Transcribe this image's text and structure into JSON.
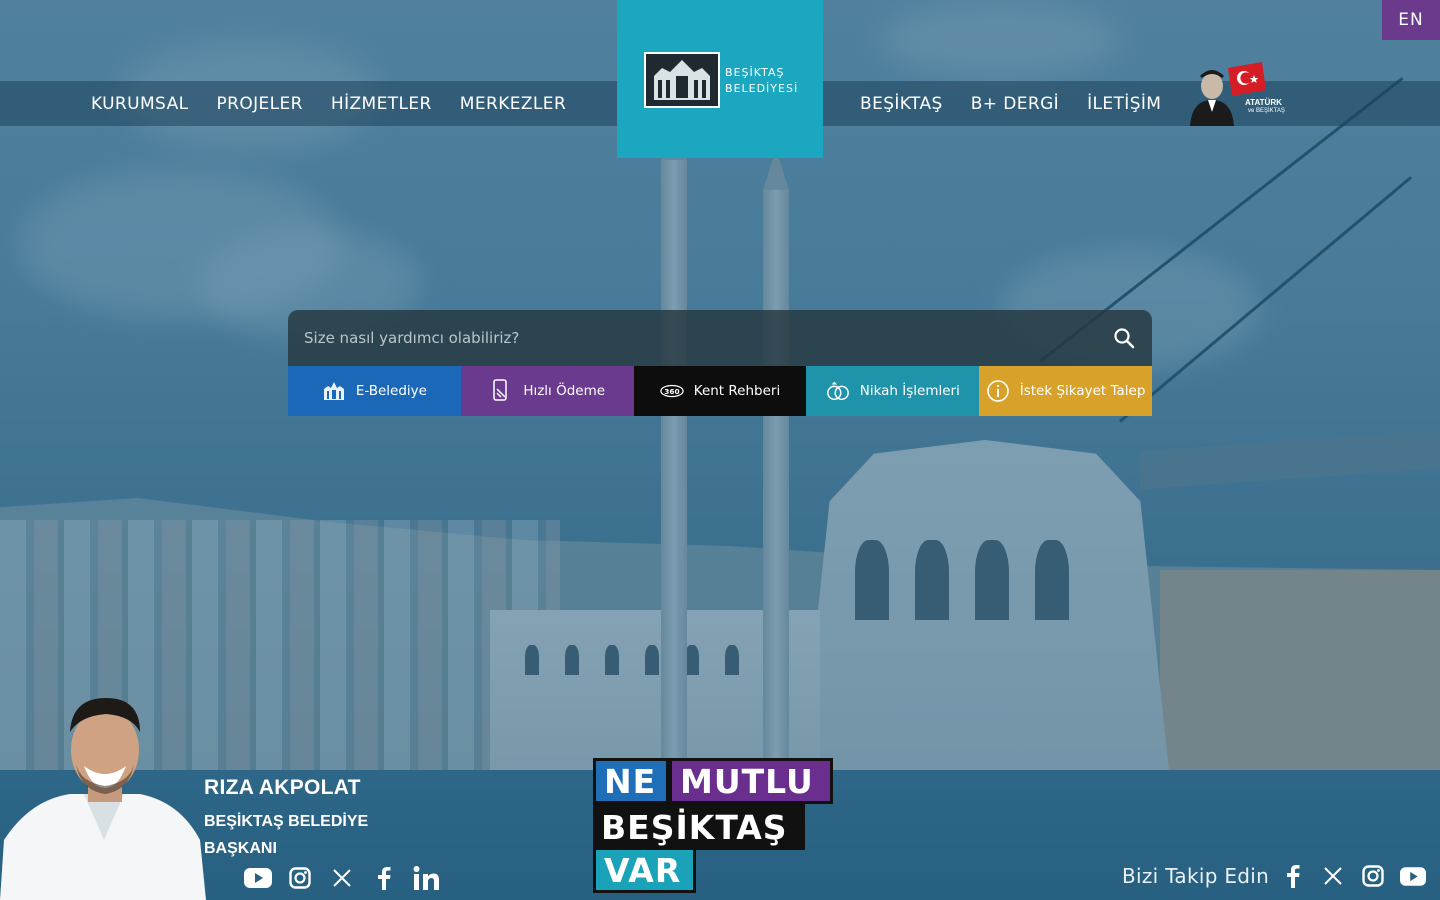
{
  "lang_toggle": "EN",
  "nav": {
    "left": [
      "KURUMSAL",
      "PROJELER",
      "HİZMETLER",
      "MERKEZLER"
    ],
    "right": [
      "BEŞİKTAŞ",
      "B+ DERGİ",
      "İLETİŞİM"
    ]
  },
  "logo": {
    "line1": "BEŞİKTAŞ",
    "line2": "BELEDİYESİ"
  },
  "ataturk_badge": {
    "title": "ATATÜRK",
    "subtitle": "ve BEŞİKTAŞ"
  },
  "search": {
    "placeholder": "Size nasıl yardımcı olabiliriz?"
  },
  "quick_links": [
    {
      "label": "E-Belediye",
      "color": "#1c68b8",
      "icon": "building-icon"
    },
    {
      "label": "Hızlı Ödeme",
      "color": "#6a3a8e",
      "icon": "card-icon"
    },
    {
      "label": "Kent Rehberi",
      "color": "#0d0d0d",
      "icon": "360-icon"
    },
    {
      "label": "Nikah İşlemleri",
      "color": "#1f93aa",
      "icon": "rings-icon"
    },
    {
      "label": "İstek Şikayet Talep",
      "color": "#d8a12a",
      "icon": "info-icon"
    }
  ],
  "mayor": {
    "name": "RIZA AKPOLAT",
    "title_line1": "BEŞİKTAŞ BELEDİYE",
    "title_line2": "BAŞKANI"
  },
  "slogan": {
    "word1": "NE",
    "word2": "MUTLU",
    "word3": "BEŞİKTAŞ",
    "word4": "VAR",
    "colors": {
      "blue": "#1f6fb8",
      "purple": "#6a2e8f",
      "black": "#111111",
      "teal": "#1aa3b8"
    }
  },
  "follow": {
    "label": "Bizi Takip Edin"
  },
  "colors": {
    "logo_bg": "#1aa7bf",
    "lang_bg": "#6b3a8c"
  }
}
